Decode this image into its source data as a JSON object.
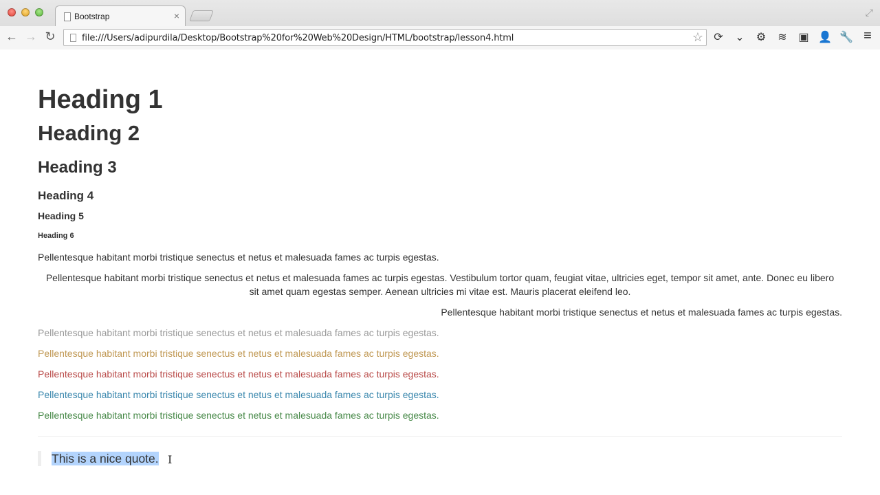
{
  "browser": {
    "tab_title": "Bootstrap",
    "tab_close_glyph": "×",
    "url": "file:///Users/adipurdila/Desktop/Bootstrap%20for%20Web%20Design/HTML/bootstrap/lesson4.html",
    "nav": {
      "back_glyph": "←",
      "forward_glyph": "→",
      "reload_glyph": "↻"
    },
    "star_glyph": "☆",
    "fullscreen_glyph": "⤢",
    "extensions": [
      {
        "name": "sync-extension-icon",
        "glyph": "⟳"
      },
      {
        "name": "pocket-extension-icon",
        "glyph": "⌄"
      },
      {
        "name": "settings-extension-icon",
        "glyph": "⚙"
      },
      {
        "name": "buffer-extension-icon",
        "glyph": "≋"
      },
      {
        "name": "evernote-extension-icon",
        "glyph": "▣"
      },
      {
        "name": "user-blocked-extension-icon",
        "glyph": "👤"
      },
      {
        "name": "wrench-extension-icon",
        "glyph": "🔧"
      },
      {
        "name": "menu-icon",
        "glyph": "≡"
      }
    ]
  },
  "page": {
    "headings": {
      "h1": "Heading 1",
      "h2": "Heading 2",
      "h3": "Heading 3",
      "h4": "Heading 4",
      "h5": "Heading 5",
      "h6": "Heading 6"
    },
    "paragraphs": {
      "left": "Pellentesque habitant morbi tristique senectus et netus et malesuada fames ac turpis egestas.",
      "center": "Pellentesque habitant morbi tristique senectus et netus et malesuada fames ac turpis egestas. Vestibulum tortor quam, feugiat vitae, ultricies eget, tempor sit amet, ante. Donec eu libero sit amet quam egestas semper. Aenean ultricies mi vitae est. Mauris placerat eleifend leo.",
      "right": "Pellentesque habitant morbi tristique senectus et netus et malesuada fames ac turpis egestas.",
      "muted": "Pellentesque habitant morbi tristique senectus et netus et malesuada fames ac turpis egestas.",
      "warning": "Pellentesque habitant morbi tristique senectus et netus et malesuada fames ac turpis egestas.",
      "error": "Pellentesque habitant morbi tristique senectus et netus et malesuada fames ac turpis egestas.",
      "info": "Pellentesque habitant morbi tristique senectus et netus et malesuada fames ac turpis egestas.",
      "success": "Pellentesque habitant morbi tristique senectus et netus et malesuada fames ac turpis egestas."
    },
    "text_colors": {
      "muted": "#999999",
      "warning": "#c09853",
      "error": "#b94a48",
      "info": "#3a87ad",
      "success": "#468847"
    },
    "blockquote": "This is a nice quote.",
    "cursor_glyph": "I"
  }
}
